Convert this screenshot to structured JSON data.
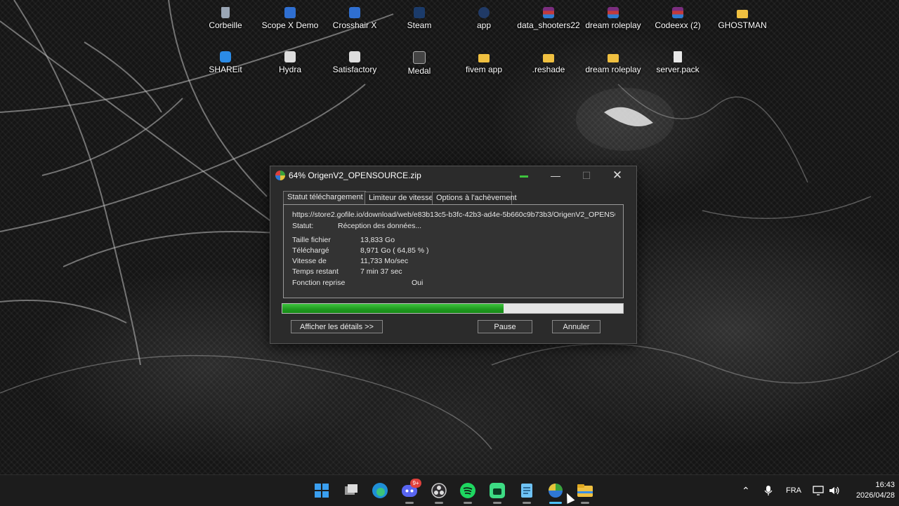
{
  "desktop_icons": [
    {
      "label": "Corbeille",
      "icon": "recycle-bin-icon"
    },
    {
      "label": "Scope X Demo",
      "icon": "scope-x-icon"
    },
    {
      "label": "Crosshair X",
      "icon": "crosshair-x-icon"
    },
    {
      "label": "Steam",
      "icon": "steam-icon"
    },
    {
      "label": "app",
      "icon": "app-icon"
    },
    {
      "label": "data_shooters22",
      "icon": "winrar-archive-icon"
    },
    {
      "label": "dream roleplay",
      "icon": "winrar-archive-icon"
    },
    {
      "label": "Codeexx (2)",
      "icon": "winrar-archive-icon"
    },
    {
      "label": "GHOSTMAN",
      "icon": "folder-icon"
    },
    {
      "label": "SHAREit",
      "icon": "shareit-icon"
    },
    {
      "label": "Hydra",
      "icon": "hydra-icon"
    },
    {
      "label": "Satisfactory",
      "icon": "satisfactory-icon"
    },
    {
      "label": "Medal",
      "icon": "medal-icon"
    },
    {
      "label": "fivem app",
      "icon": "folder-icon"
    },
    {
      "label": ".reshade",
      "icon": "folder-icon"
    },
    {
      "label": "dream roleplay",
      "icon": "folder-icon"
    },
    {
      "label": "server.pack",
      "icon": "file-icon"
    }
  ],
  "window": {
    "title": "64% OrigenV2_OPENSOURCE.zip",
    "minimize": "—",
    "maximize": "☐",
    "close": "✕",
    "tabs": [
      "Statut téléchargement",
      "Limiteur de vitesse",
      "Options à l'achèvement"
    ],
    "url": "https://store2.gofile.io/download/web/e83b13c5-b3fc-42b3-ad4e-5b660c9b73b3/OrigenV2_OPENSC",
    "status_label": "Statut:",
    "status_value": "Réception des données...",
    "file_size_label": "Taille fichier",
    "file_size_value": "13,833  Go",
    "downloaded_label": "Téléchargé",
    "downloaded_value": "8,971  Go  ( 64,85 % )",
    "speed_label": "Vitesse de",
    "speed_value": "11,733  Mo/sec",
    "remaining_label": "Temps restant",
    "remaining_value": "7 min 37 sec",
    "resume_label": "Fonction reprise",
    "resume_value": "Oui",
    "progress_percent": 64.85,
    "details_button": "Afficher les détails >>",
    "pause_button": "Pause",
    "cancel_button": "Annuler"
  },
  "taskbar": {
    "apps": [
      "start-icon",
      "task-view-icon",
      "edge-icon",
      "discord-icon",
      "obs-icon",
      "spotify-icon",
      "android-icon",
      "notepad-icon",
      "download-manager-icon",
      "file-explorer-icon"
    ],
    "discord_badge": "9+",
    "language": "FRA",
    "time": "16:43",
    "date": "2026/04/28"
  }
}
